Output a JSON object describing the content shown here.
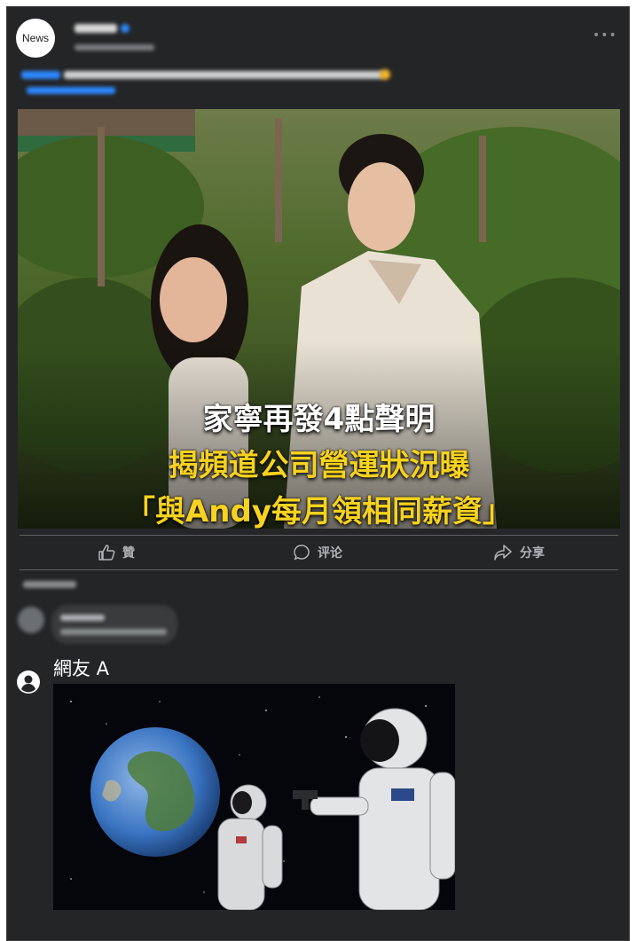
{
  "post": {
    "page_avatar_text": "News",
    "blurred_page_name": "",
    "blurred_timestamp": ""
  },
  "image_caption": {
    "line1": "家寧再發4點聲明",
    "line2": "揭頻道公司營運狀況曝",
    "line3": "「與Andy每月領相同薪資」"
  },
  "actions": {
    "like": "贊",
    "comment": "评论",
    "share": "分享"
  },
  "comments": {
    "reply_user": "網友 A"
  },
  "colors": {
    "background": "#242526",
    "text_primary": "#e4e6eb",
    "text_secondary": "#b0b3b8",
    "caption_yellow": "#f7d21e",
    "link_blue": "#2d88ff"
  },
  "icons": [
    "more-icon",
    "verified-badge-icon",
    "like-icon",
    "comment-icon",
    "share-icon",
    "user-avatar-icon"
  ]
}
